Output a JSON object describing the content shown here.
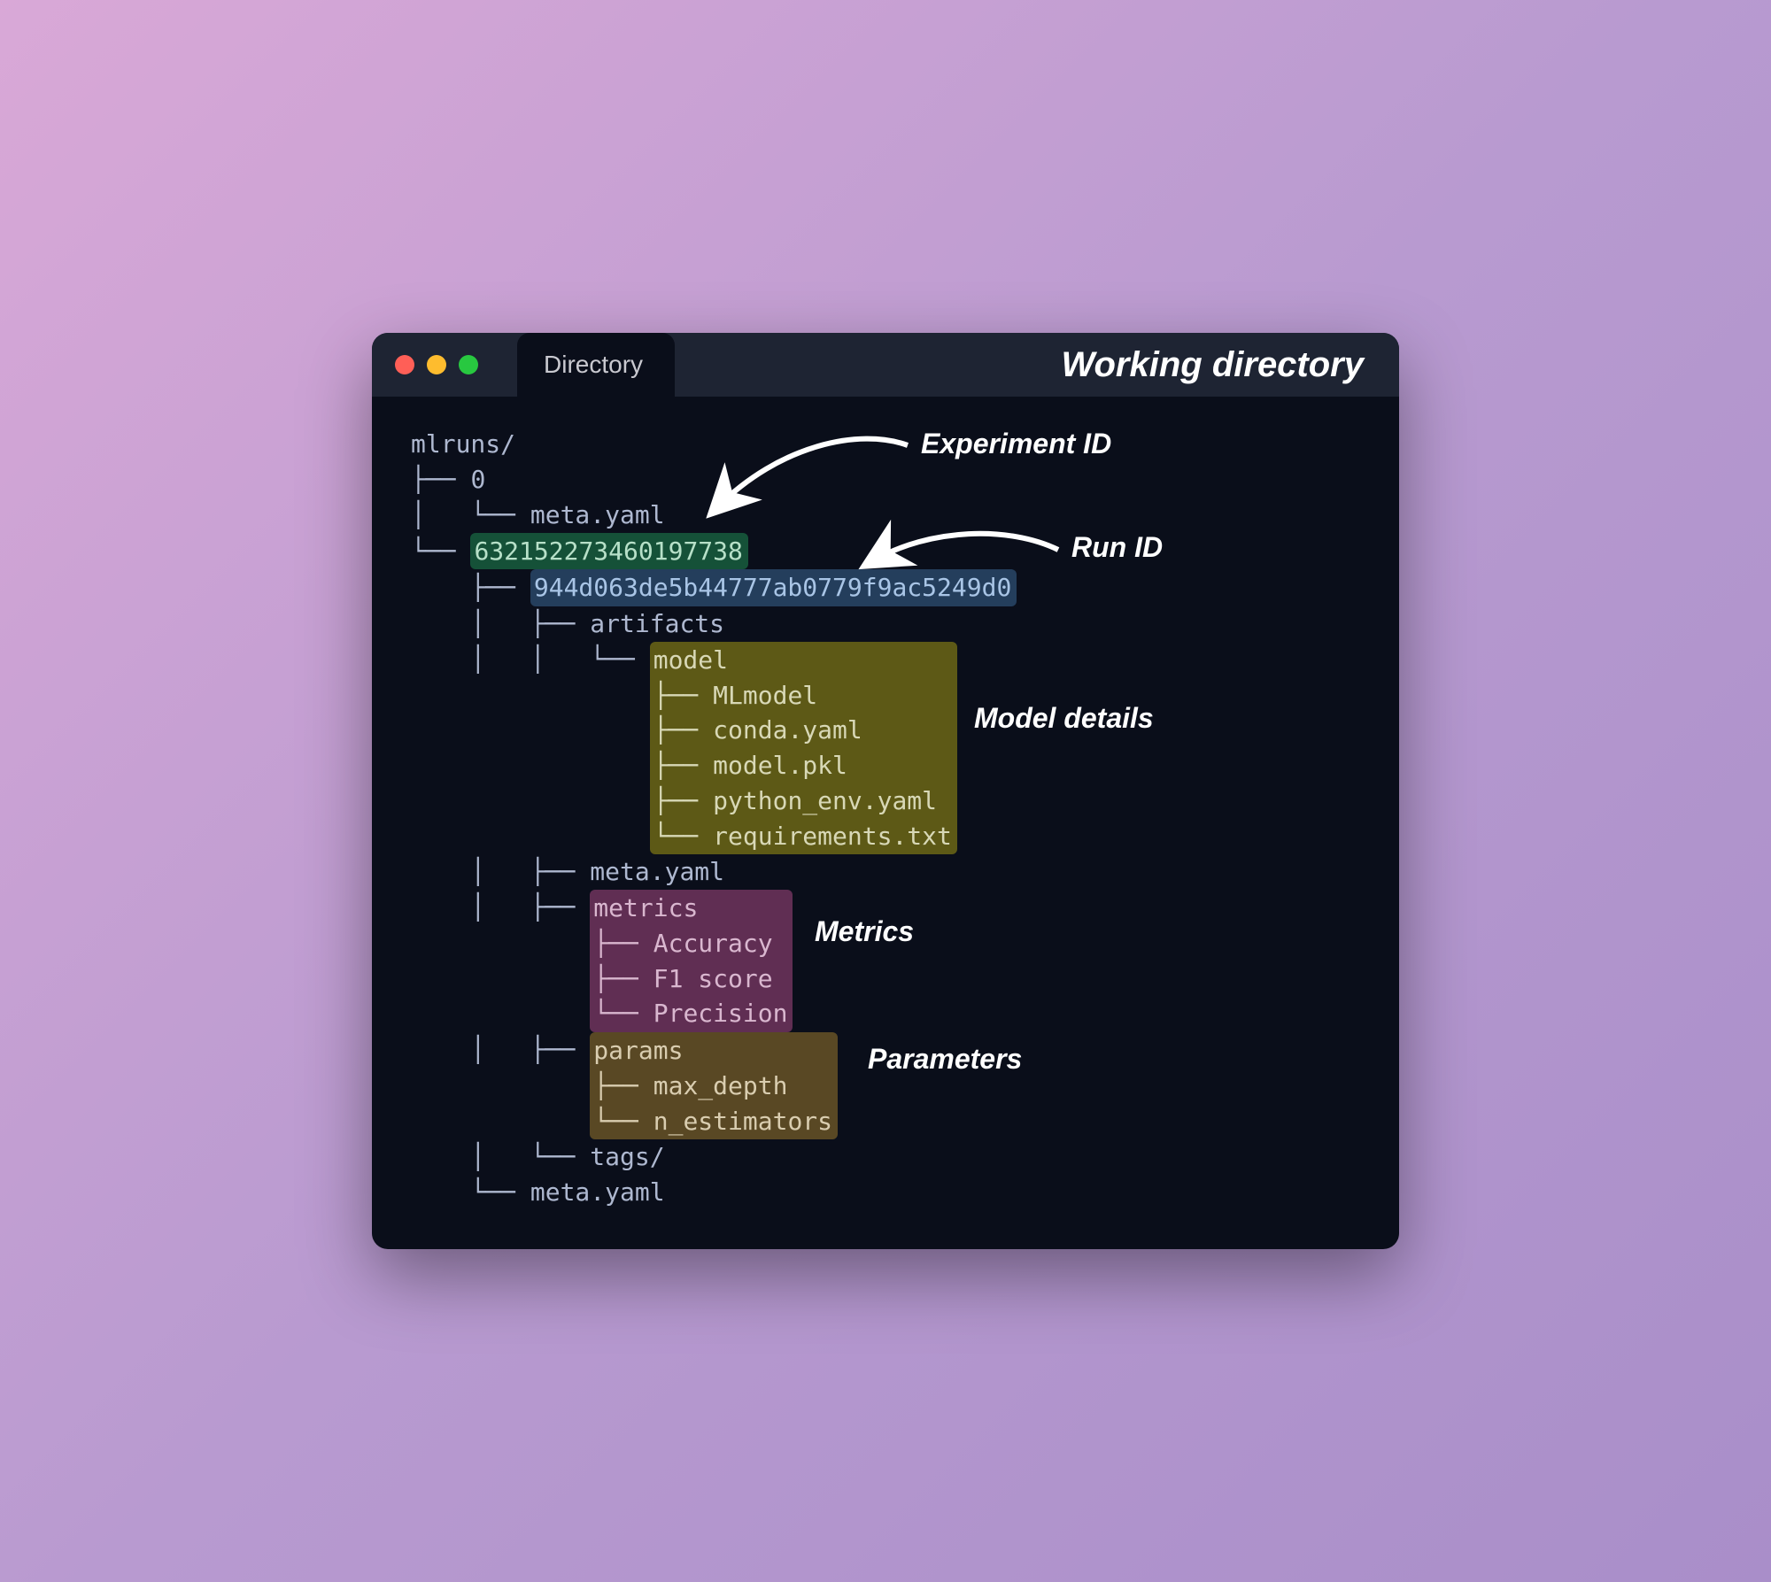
{
  "window": {
    "tab_label": "Directory",
    "title": "Working directory"
  },
  "tree": {
    "root": "mlruns/",
    "exp_zero": "0",
    "exp_zero_meta": "meta.yaml",
    "experiment_id": "632152273460197738",
    "run_id": "944d063de5b44777ab0779f9ac5249d0",
    "artifacts": "artifacts",
    "model_dir": "model",
    "model_files": {
      "mlmodel": "MLmodel",
      "conda": "conda.yaml",
      "pkl": "model.pkl",
      "pyenv": "python_env.yaml",
      "reqs": "requirements.txt"
    },
    "run_meta": "meta.yaml",
    "metrics_dir": "metrics",
    "metrics": {
      "acc": "Accuracy",
      "f1": "F1 score",
      "prec": "Precision"
    },
    "params_dir": "params",
    "params": {
      "max_depth": "max_depth",
      "n_est": "n_estimators"
    },
    "tags": "tags/",
    "exp_meta": "meta.yaml"
  },
  "annotations": {
    "experiment_id": "Experiment ID",
    "run_id": "Run ID",
    "model_details": "Model details",
    "metrics": "Metrics",
    "parameters": "Parameters"
  }
}
